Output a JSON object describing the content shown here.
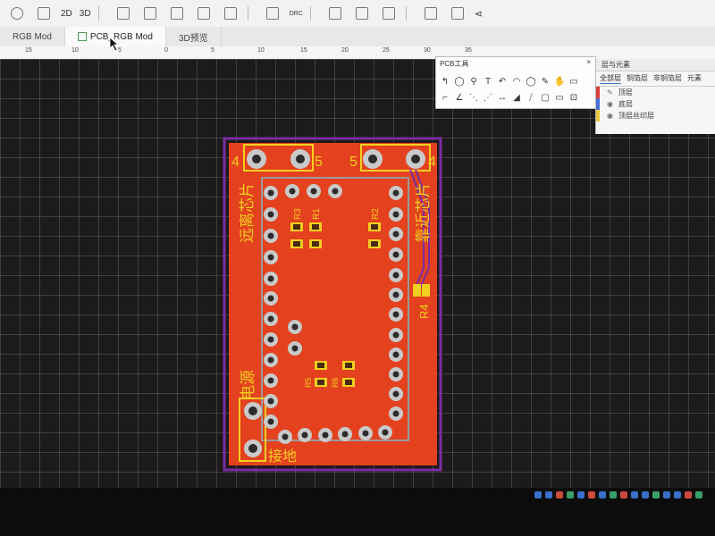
{
  "toolbar": {
    "btn_2d": "2D",
    "btn_3d": "3D",
    "drc": "DRC"
  },
  "tabs": [
    {
      "label": "RGB Mod"
    },
    {
      "label": "PCB_RGB Mod"
    },
    {
      "label": "3D预览"
    }
  ],
  "ruler": {
    "ticks": [
      "15",
      "10",
      "5",
      "0",
      "5",
      "10",
      "15",
      "20",
      "25",
      "30",
      "35"
    ]
  },
  "pcb_tools": {
    "title": "PCB工具",
    "close": "×",
    "row1": [
      "↰",
      "◯",
      "⚲",
      "T",
      "↶",
      "◠",
      "◯",
      "✎",
      "✋",
      "▭"
    ],
    "row2": [
      "⌐",
      "∠",
      "⋱",
      "⋰",
      "↔",
      "◢",
      "⧸",
      "▢",
      "▭",
      "⊡"
    ]
  },
  "layers": {
    "title": "层与元素",
    "tabs": [
      "全部层",
      "铜箔层",
      "非铜箔层",
      "元素"
    ],
    "items": [
      {
        "label": "顶层",
        "color": "#d93b3b"
      },
      {
        "label": "底层",
        "color": "#4a6dd8"
      },
      {
        "label": "顶层丝印层",
        "color": "#e8c93a"
      }
    ]
  },
  "board": {
    "labels": {
      "n4_left": "4",
      "n5_left": "5",
      "n5_right": "5",
      "n4_right": "4",
      "far_chip": "远离芯片",
      "near_chip": "靠近芯片",
      "power": "电源",
      "ground": "接地",
      "r4": "R4",
      "r3": "R3",
      "r1": "R1",
      "r2": "R2",
      "r5": "R5",
      "r6": "R6"
    }
  },
  "colors": {
    "board": "#e4411e",
    "outline": "#7a2ea0",
    "silk": "#f2d020",
    "pad": "#c9c9c9",
    "pad_hole": "#2b2b2b",
    "grid": "#1c1a1a"
  }
}
